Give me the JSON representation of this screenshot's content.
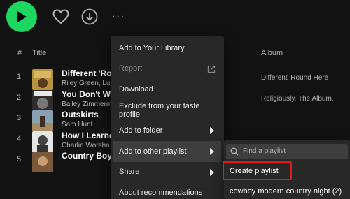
{
  "toolbar": {
    "play_icon": "play-icon",
    "heart_icon": "heart-icon",
    "download_icon": "download-icon",
    "more_icon": "more-options-icon",
    "more_text": "···",
    "accent": "#1ed760"
  },
  "table_header": {
    "number": "#",
    "title": "Title",
    "album": "Album"
  },
  "tracks": [
    {
      "num": "1",
      "title": "Different 'Round Here",
      "title_visible": "Different 'Ro",
      "artist": "Riley Green, Lu",
      "album": "Different 'Round Here"
    },
    {
      "num": "2",
      "title": "You Don't Wa",
      "title_visible": "You Don't Wa",
      "artist": "Bailey Zimmerm",
      "album": "Religiously. The Album."
    },
    {
      "num": "3",
      "title": "Outskirts",
      "title_visible": "Outskirts",
      "artist": "Sam Hunt",
      "album": ""
    },
    {
      "num": "4",
      "title": "How I Learne",
      "title_visible": "How I Learne",
      "artist": "Charlie Worsha",
      "album": ""
    },
    {
      "num": "5",
      "title": "Country Boy'",
      "title_visible": "Country Boy'",
      "artist": "",
      "album": ""
    }
  ],
  "context_menu": {
    "items": [
      {
        "label": "Add to Your Library"
      },
      {
        "label": "Report"
      },
      {
        "label": "Download"
      },
      {
        "label": "Exclude from your taste profile"
      },
      {
        "label": "Add to folder"
      },
      {
        "label": "Add to other playlist"
      },
      {
        "label": "Share"
      },
      {
        "label": "About recommendations"
      }
    ]
  },
  "submenu": {
    "search_placeholder": "Find a playlist",
    "create_label": "Create playlist",
    "playlists": [
      "cowboy modern country night (2)"
    ]
  },
  "highlight_color": "#e01b1b"
}
